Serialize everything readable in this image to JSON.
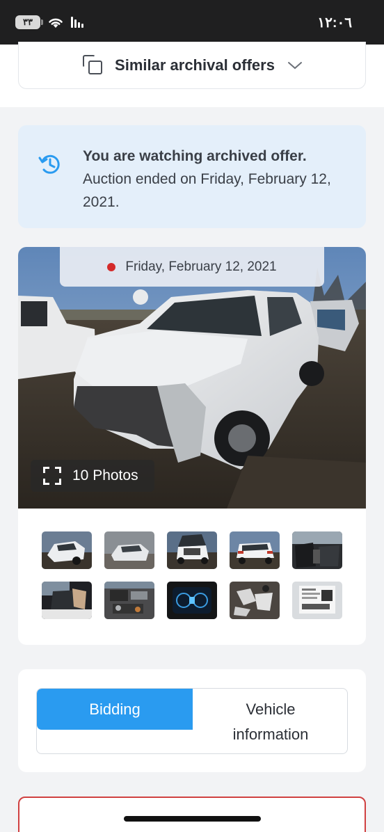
{
  "status_bar": {
    "time": "١٢:٠٦",
    "battery": "٣٣"
  },
  "similar": {
    "label": "Similar archival offers"
  },
  "info_banner": {
    "title": "You are watching archived offer.",
    "body": "Auction ended on Friday, February 12, 2021."
  },
  "gallery": {
    "date": "Friday, February 12, 2021",
    "photos_label": "10 Photos",
    "thumbnails": [
      "front-damage",
      "front-angle",
      "rear-hatch-open",
      "rear-view",
      "interior-front",
      "interior-rear",
      "engine-bay",
      "dashboard-cluster",
      "airbag-parts",
      "window-sticker"
    ]
  },
  "tabs": {
    "bidding": "Bidding",
    "vehicle_info": "Vehicle information"
  },
  "colors": {
    "accent": "#2a9bf0",
    "banner_bg": "#e4effa",
    "alert_border": "#d04040",
    "status_dot": "#d42a2a"
  }
}
